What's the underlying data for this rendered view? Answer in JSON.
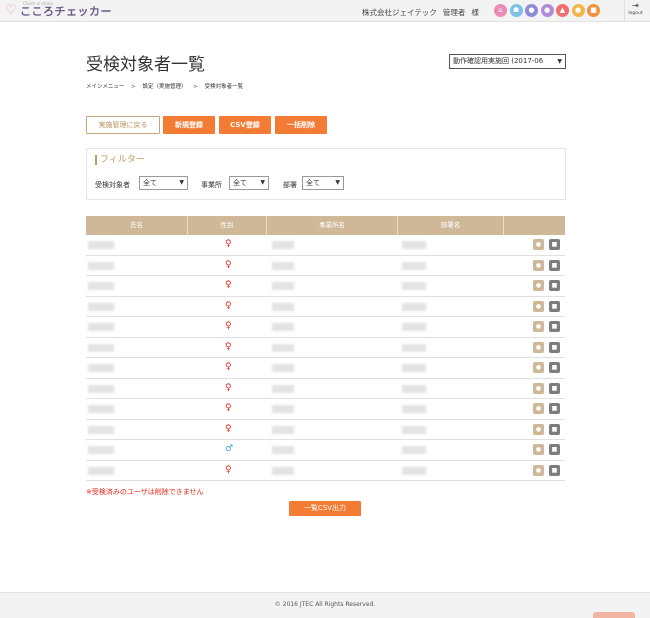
{
  "header": {
    "logo_sub": "Check in stress",
    "logo_text": "こころチェッカー",
    "company": "株式会社ジェイテック",
    "user": "管理者",
    "honorific": "様",
    "nav_icons": [
      {
        "name": "home-icon",
        "color": "#ec8ab4",
        "glyph": "⌂"
      },
      {
        "name": "group-icon",
        "color": "#7cc2e8",
        "glyph": "☗"
      },
      {
        "name": "user-icon",
        "color": "#8d8ad6",
        "glyph": "●"
      },
      {
        "name": "users-icon",
        "color": "#b28ad6",
        "glyph": "●"
      },
      {
        "name": "warning-icon",
        "color": "#ef6f6f",
        "glyph": "▲"
      },
      {
        "name": "settings-icon",
        "color": "#f0b64a",
        "glyph": "●"
      },
      {
        "name": "document-icon",
        "color": "#f0923c",
        "glyph": "■"
      }
    ],
    "logout_label": "logout",
    "logout_glyph": "⇥"
  },
  "page": {
    "title": "受検対象者一覧",
    "round_select": "動作確認用実施回 (2017-06",
    "breadcrumb": [
      "メインメニュー",
      "設定（実施管理）",
      "受検対象者一覧"
    ],
    "breadcrumb_sep": ">"
  },
  "buttons": {
    "back": "実施管理に戻る",
    "new": "新規登録",
    "csv_import": "CSV登録",
    "bulk_delete": "一括削除"
  },
  "filter": {
    "title": "フィルター",
    "target_label": "受検対象者",
    "target_value": "全て",
    "office_label": "事業所",
    "office_value": "全て",
    "dept_label": "部署",
    "dept_value": "全て"
  },
  "table": {
    "headers": [
      "氏名",
      "性別",
      "事業所名",
      "部署名",
      ""
    ],
    "rows": [
      {
        "gender": "female"
      },
      {
        "gender": "female"
      },
      {
        "gender": "female"
      },
      {
        "gender": "female"
      },
      {
        "gender": "female"
      },
      {
        "gender": "female"
      },
      {
        "gender": "female"
      },
      {
        "gender": "female"
      },
      {
        "gender": "female"
      },
      {
        "gender": "female"
      },
      {
        "gender": "male"
      },
      {
        "gender": "female"
      }
    ],
    "female_color": "#e8271a",
    "male_color": "#3aa3e3"
  },
  "note": "※受検済みのユーザは削除できません",
  "csv_export": "一覧CSV出力",
  "footer": {
    "copyright": "© 2016 JTEC All Rights Reserved."
  }
}
